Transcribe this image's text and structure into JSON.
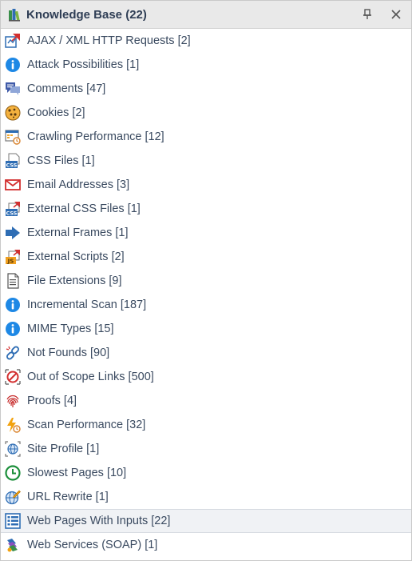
{
  "panel": {
    "title": "Knowledge Base (22)",
    "pin_icon": "pin-icon",
    "close_icon": "close-icon"
  },
  "items": [
    {
      "label": "AJAX / XML HTTP Requests [2]",
      "icon": "ajax-icon"
    },
    {
      "label": "Attack Possibilities [1]",
      "icon": "info-icon"
    },
    {
      "label": "Comments [47]",
      "icon": "comments-icon"
    },
    {
      "label": "Cookies [2]",
      "icon": "cookie-icon"
    },
    {
      "label": "Crawling Performance [12]",
      "icon": "crawling-performance-icon"
    },
    {
      "label": "CSS Files [1]",
      "icon": "css-file-icon"
    },
    {
      "label": "Email Addresses [3]",
      "icon": "email-icon"
    },
    {
      "label": "External CSS Files [1]",
      "icon": "external-css-icon"
    },
    {
      "label": "External Frames [1]",
      "icon": "arrow-right-icon"
    },
    {
      "label": "External Scripts [2]",
      "icon": "external-js-icon"
    },
    {
      "label": "File Extensions [9]",
      "icon": "file-icon"
    },
    {
      "label": "Incremental Scan [187]",
      "icon": "info-icon"
    },
    {
      "label": "MIME Types [15]",
      "icon": "info-icon"
    },
    {
      "label": "Not Founds [90]",
      "icon": "broken-link-icon"
    },
    {
      "label": "Out of Scope Links [500]",
      "icon": "out-of-scope-icon"
    },
    {
      "label": "Proofs [4]",
      "icon": "fingerprint-icon"
    },
    {
      "label": "Scan Performance [32]",
      "icon": "scan-performance-icon"
    },
    {
      "label": "Site Profile [1]",
      "icon": "site-profile-icon"
    },
    {
      "label": "Slowest Pages [10]",
      "icon": "clock-icon"
    },
    {
      "label": "URL Rewrite [1]",
      "icon": "url-rewrite-icon"
    },
    {
      "label": "Web Pages With Inputs [22]",
      "icon": "form-list-icon",
      "selected": true
    },
    {
      "label": "Web Services (SOAP) [1]",
      "icon": "web-services-icon"
    }
  ],
  "colors": {
    "title_text": "#2f3e55",
    "item_text": "#3a4a60",
    "info_blue": "#1e88e5",
    "selection_bg": "#f0f2f5"
  }
}
